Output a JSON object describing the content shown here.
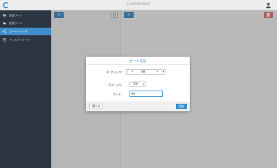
{
  "header": {
    "title": "Dashboard"
  },
  "sidebar": {
    "items": [
      {
        "label": "物理サーバ",
        "icon": "server-icon",
        "active": false
      },
      {
        "label": "仮想サーバ",
        "icon": "cloud-icon",
        "active": false
      },
      {
        "label": "ロードバランサ",
        "icon": "share-icon",
        "active": true
      },
      {
        "label": "ディスクイメージ",
        "icon": "disk-icon",
        "active": false
      }
    ]
  },
  "toolbar": {
    "left_add": "+",
    "refresh_icon": "refresh-icon",
    "right_add": "+",
    "delete_icon": "trash-icon"
  },
  "modal": {
    "title": "ポート追加",
    "ip_label": "IP アドレス：",
    "ip_value": "↗",
    "ip_value_2": ":88",
    "ip_arrow": "↗",
    "protocol_label": "プロトコル：",
    "protocol_value": "TCP",
    "port_label": "ポート：",
    "port_value": "80",
    "close_label": "閉じる",
    "add_label": "追加"
  },
  "colors": {
    "accent": "#3e8ecb",
    "sidebar": "#2c3643",
    "danger": "#e57373"
  }
}
